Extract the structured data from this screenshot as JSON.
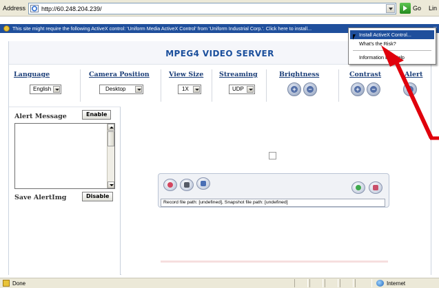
{
  "browser": {
    "address_label": "Address",
    "url": "http://60.248.204.239/",
    "go_label": "Go",
    "links_label": "Lin"
  },
  "infobar": {
    "text": "This site might require the following ActiveX control: 'Uniform Media ActiveX Control' from 'Uniform Industrial Corp.'. Click here to install..."
  },
  "context_menu": {
    "items": [
      {
        "label": "Install ActiveX Control...",
        "active": true
      },
      {
        "label": "What's the Risk?",
        "active": false
      },
      {
        "label": "Information Bar Help",
        "active": false
      }
    ]
  },
  "page": {
    "title": "MPEG4 VIDEO SERVER",
    "controls": {
      "language": {
        "label": "Language",
        "value": "English"
      },
      "camera_position": {
        "label": "Camera Position",
        "value": "Desktop"
      },
      "view_size": {
        "label": "View Size",
        "value": "1X"
      },
      "streaming": {
        "label": "Streaming",
        "value": "UDP"
      },
      "brightness": {
        "label": "Brightness",
        "plus": "+",
        "minus": "−"
      },
      "contrast": {
        "label": "Contrast",
        "plus": "+",
        "minus": "−"
      },
      "alert": {
        "label": "Alert"
      }
    },
    "alert_panel": {
      "alert_message_label": "Alert Message",
      "enable_label": "Enable",
      "save_alertimg_label": "Save AlertImg",
      "disable_label": "Disable"
    },
    "player": {
      "file_path_text": "Record file path: [undefined], Snapshot file path: [undefined]"
    }
  },
  "statusbar": {
    "status_text": "Done",
    "zone_text": "Internet"
  },
  "colors": {
    "accent": "#1b4f9c",
    "infobar": "#1f4f9c",
    "annotation_arrow": "#e0000c"
  },
  "icons": [
    "ie-page-icon",
    "go-arrow-icon",
    "shield-icon",
    "plus-icon",
    "minus-icon",
    "alert-icon",
    "record-icon",
    "snapshot-icon",
    "path-icon",
    "audio-icon",
    "stop-icon",
    "globe-icon"
  ]
}
